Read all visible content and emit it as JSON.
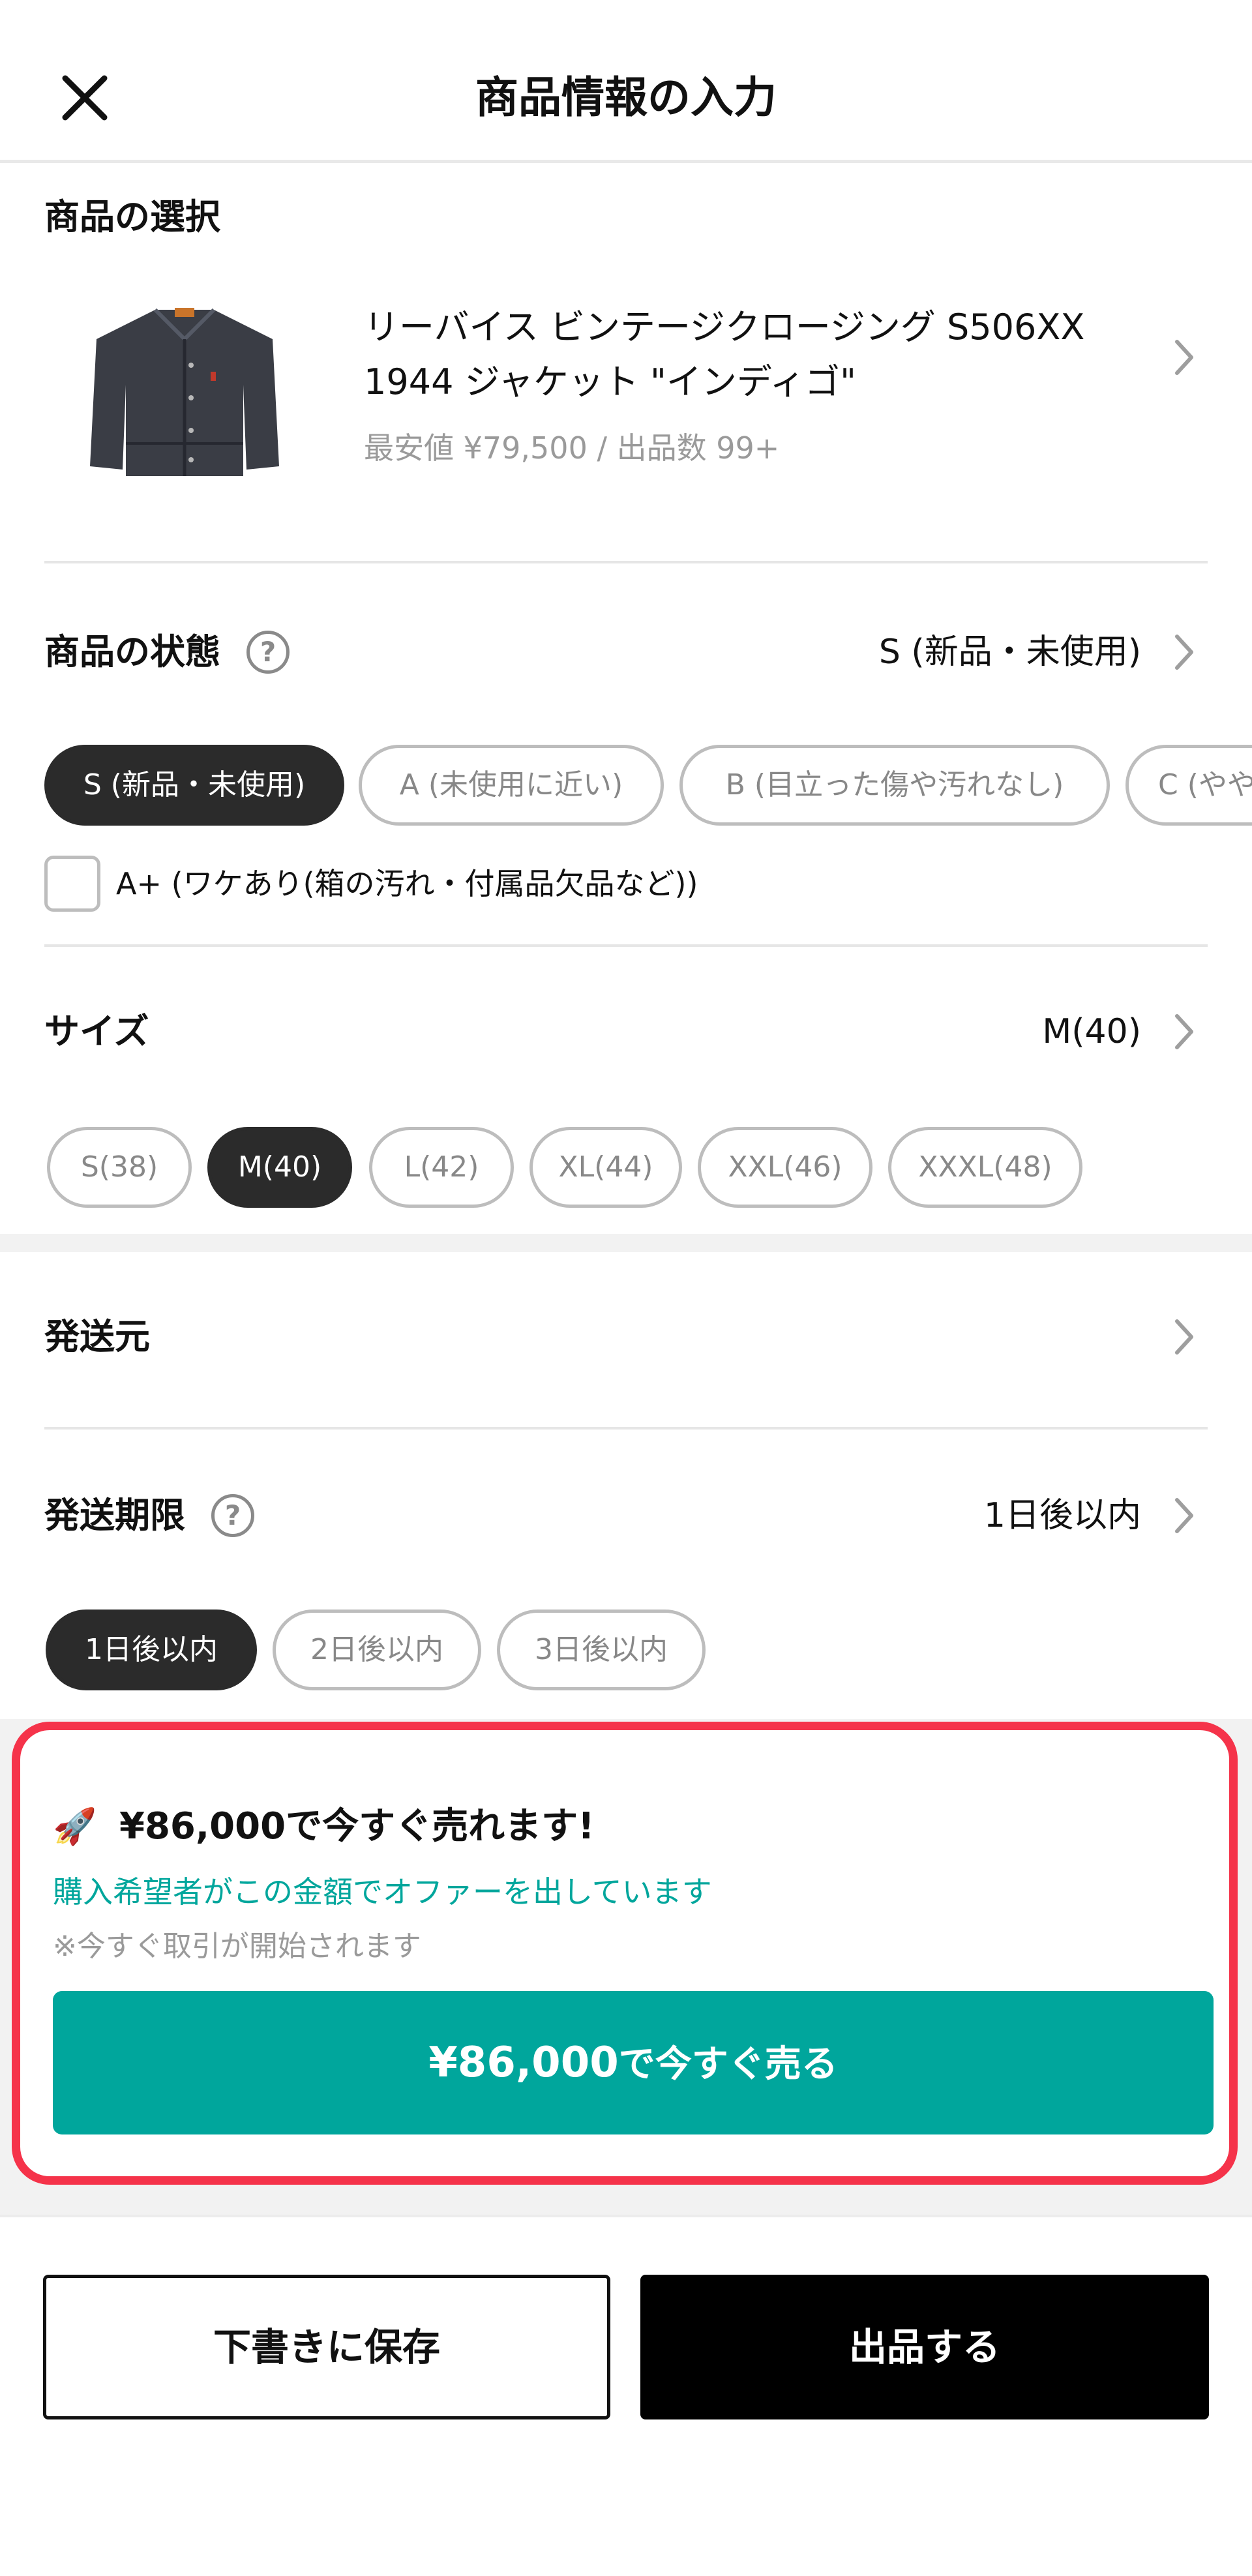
{
  "header": {
    "title": "商品情報の入力"
  },
  "product_select": {
    "section_title": "商品の選択",
    "name_line1": "リーバイス ビンテージクロージング S506XX",
    "name_line2": "1944 ジャケット \"インディゴ\"",
    "meta": "最安値 ¥79,500 / 出品数 99+"
  },
  "condition": {
    "label": "商品の状態",
    "value": "S (新品・未使用)",
    "chips": [
      "S (新品・未使用)",
      "A (未使用に近い)",
      "B (目立った傷や汚れなし)",
      "C (やや"
    ],
    "selected_index": 0,
    "checkbox_label": "A+ (ワケあり(箱の汚れ・付属品欠品など))"
  },
  "size": {
    "label": "サイズ",
    "value": "M(40)",
    "chips": [
      "S(38)",
      "M(40)",
      "L(42)",
      "XL(44)",
      "XXL(46)",
      "XXXL(48)"
    ],
    "selected_index": 1
  },
  "origin": {
    "label": "発送元"
  },
  "deadline": {
    "label": "発送期限",
    "value": "1日後以内",
    "chips": [
      "1日後以内",
      "2日後以内",
      "3日後以内"
    ],
    "selected_index": 0
  },
  "offer": {
    "emoji": "🚀",
    "title": "¥86,000で今すぐ売れます!",
    "subtitle": "購入希望者がこの金額でオファーを出しています",
    "note": "※今すぐ取引が開始されます",
    "button_price": "¥86,000",
    "button_suffix": "で今すぐ売る"
  },
  "footer": {
    "draft_label": "下書きに保存",
    "submit_label": "出品する"
  },
  "colors": {
    "accent": "#00a69c",
    "highlight_border": "#f5334a",
    "selected_chip": "#2b2b2b"
  }
}
